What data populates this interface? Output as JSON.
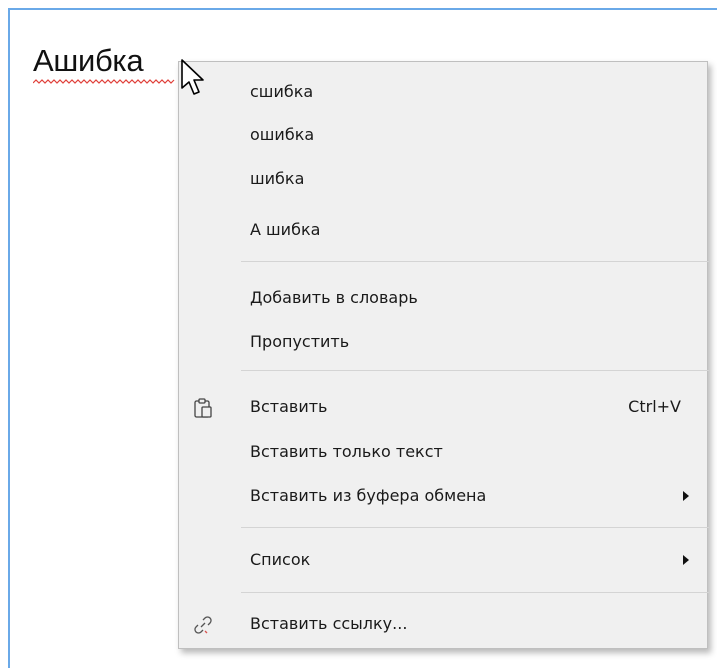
{
  "document": {
    "word": "Ашибка"
  },
  "context_menu": {
    "suggestions": [
      "сшибка",
      "ошибка",
      "шибка",
      "А шибка"
    ],
    "add_to_dictionary": "Добавить в словарь",
    "skip": "Пропустить",
    "paste": {
      "label": "Вставить",
      "shortcut": "Ctrl+V",
      "icon": "clipboard-paste-icon"
    },
    "paste_text_only": "Вставить только текст",
    "paste_from_clipboard": "Вставить из буфера обмена",
    "list": "Список",
    "insert_link": {
      "label": "Вставить ссылку...",
      "icon": "link-icon"
    }
  },
  "colors": {
    "editor_border": "#6aa9e8",
    "menu_background": "#f0f0f0",
    "spellcheck_underline": "#e0403a"
  }
}
